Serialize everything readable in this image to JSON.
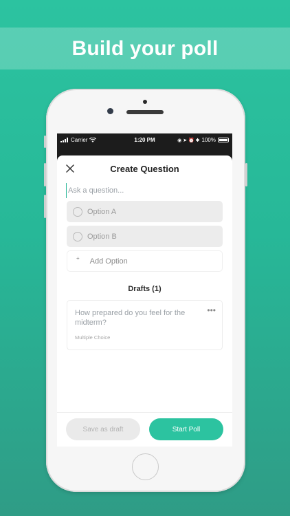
{
  "banner": {
    "title": "Build your poll"
  },
  "status_bar": {
    "carrier": "Carrier",
    "time": "1:20 PM",
    "battery": "100%"
  },
  "sheet": {
    "title": "Create Question",
    "question_placeholder": "Ask a question...",
    "options": [
      {
        "label": "Option A"
      },
      {
        "label": "Option B"
      }
    ],
    "add_option_label": "Add Option",
    "add_option_symbol": "+",
    "drafts_heading": "Drafts (1)",
    "drafts": [
      {
        "question": "How prepared do you feel for the midterm?",
        "type": "Multiple Choice"
      }
    ],
    "more_symbol": "•••"
  },
  "footer": {
    "save_draft_label": "Save as draft",
    "start_poll_label": "Start Poll"
  },
  "colors": {
    "accent": "#2cc3a0",
    "background_top": "#2cc3a0",
    "background_bottom": "#2f9c86"
  },
  "icons": {
    "close": "close-icon",
    "signal": "signal-icon",
    "wifi": "wifi-icon",
    "battery": "battery-icon"
  }
}
